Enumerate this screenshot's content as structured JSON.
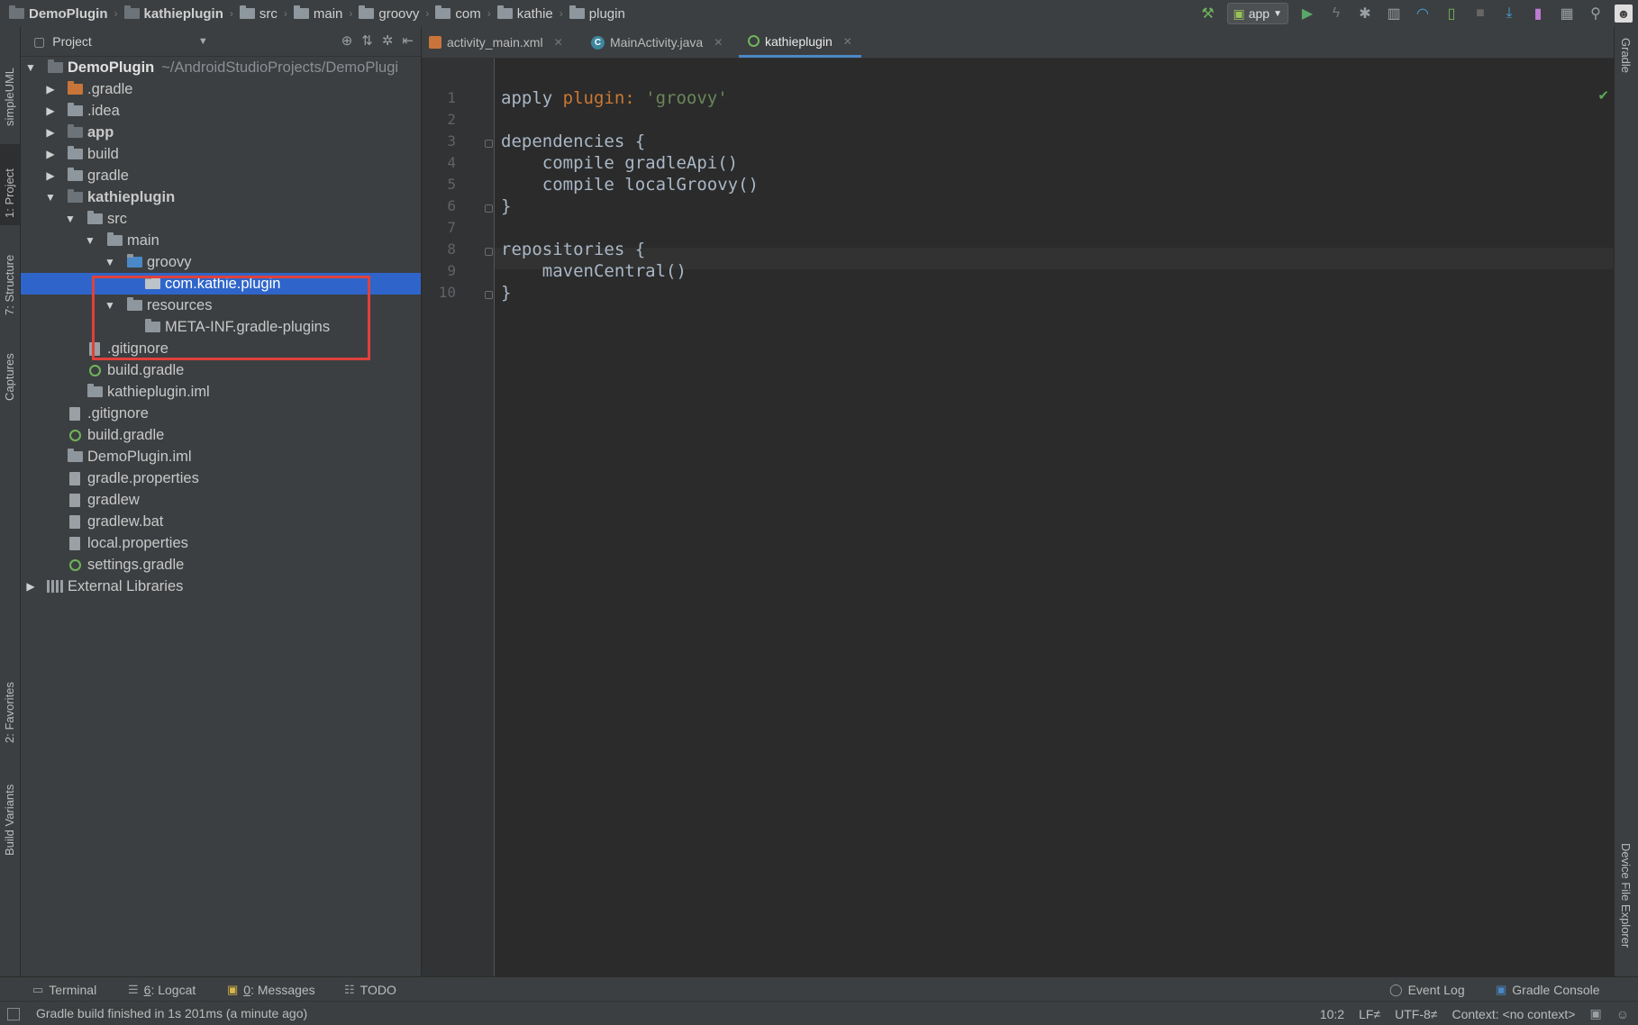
{
  "breadcrumbs": [
    "DemoPlugin",
    "kathieplugin",
    "src",
    "main",
    "groovy",
    "com",
    "kathie",
    "plugin"
  ],
  "toolbar": {
    "run_config": "app",
    "icons": [
      "hammer-icon",
      "run-icon",
      "apply-changes-icon",
      "debug-icon",
      "profile-icon",
      "attach-debugger-icon",
      "coverage-icon",
      "stop-icon",
      "sdk-manager-icon",
      "avd-manager-icon",
      "project-structure-icon",
      "search-icon",
      "avatar"
    ]
  },
  "left_strip": [
    "simpleUML",
    "1: Project",
    "7: Structure",
    "Captures",
    "2: Favorites",
    "Build Variants"
  ],
  "right_strip": [
    "Gradle",
    "Device File Explorer"
  ],
  "project_panel": {
    "title": "Project",
    "root_name": "DemoPlugin",
    "root_path": "~/AndroidStudioProjects/DemoPlugi",
    "items": [
      ".gradle",
      ".idea",
      "app",
      "build",
      "gradle",
      "kathieplugin",
      "src",
      "main",
      "groovy",
      "com.kathie.plugin",
      "resources",
      "META-INF.gradle-plugins",
      ".gitignore",
      "build.gradle",
      "kathieplugin.iml",
      ".gitignore",
      "build.gradle",
      "DemoPlugin.iml",
      "gradle.properties",
      "gradlew",
      "gradlew.bat",
      "local.properties",
      "settings.gradle",
      "External Libraries"
    ]
  },
  "editor": {
    "tabs": [
      "activity_main.xml",
      "MainActivity.java",
      "kathieplugin"
    ],
    "active_tab": "kathieplugin",
    "line_numbers": [
      "1",
      "2",
      "3",
      "4",
      "5",
      "6",
      "7",
      "8",
      "9",
      "10"
    ],
    "code": {
      "l1_a": "apply ",
      "l1_b": "plugin: ",
      "l1_c": "'groovy'",
      "l3": "dependencies {",
      "l4": "    compile gradleApi()",
      "l5": "    compile localGroovy()",
      "l6": "}",
      "l8": "repositories {",
      "l9": "    mavenCentral()",
      "l10": "}"
    }
  },
  "bottom_tools": {
    "terminal": "Terminal",
    "logcat_num": "6",
    "logcat": ": Logcat",
    "messages_num": "0",
    "messages": ": Messages",
    "todo": "TODO",
    "event_log": "Event Log",
    "gradle_console": "Gradle Console"
  },
  "status": {
    "message": "Gradle build finished in 1s 201ms (a minute ago)",
    "position": "10:2",
    "line_sep": "LF≠",
    "encoding": "UTF-8≠",
    "context": "Context: <no context>"
  },
  "colors": {
    "selection": "#2f65ca",
    "highlight_box": "#e0413c",
    "keyword": "#cc7832",
    "string": "#6a8759"
  }
}
